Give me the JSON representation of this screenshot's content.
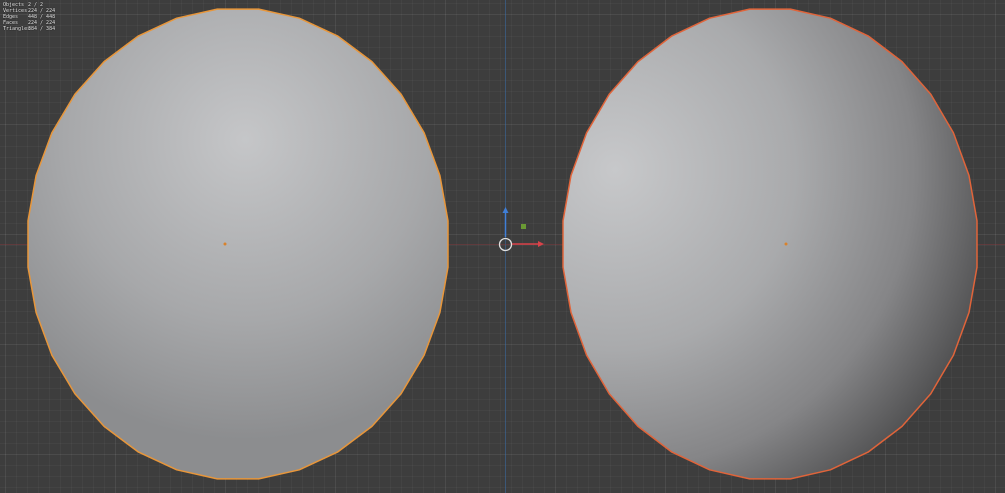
{
  "viewport": {
    "background": "#3d3d3d",
    "selected_outline": "#e8963a",
    "active_outline": "#e0643a",
    "origin_dot": "#d9822b",
    "axis_x_color": "#d8434a",
    "axis_y_color": "#3f7fd8",
    "axis_z_plane_color": "#6a9a34"
  },
  "stats": [
    {
      "label": "Objects",
      "value": "2 / 2"
    },
    {
      "label": "Vertices",
      "value": "224 / 224"
    },
    {
      "label": "Edges",
      "value": "448 / 448"
    },
    {
      "label": "Faces",
      "value": "224 / 224"
    },
    {
      "label": "Triangles",
      "value": "384 / 384"
    }
  ]
}
